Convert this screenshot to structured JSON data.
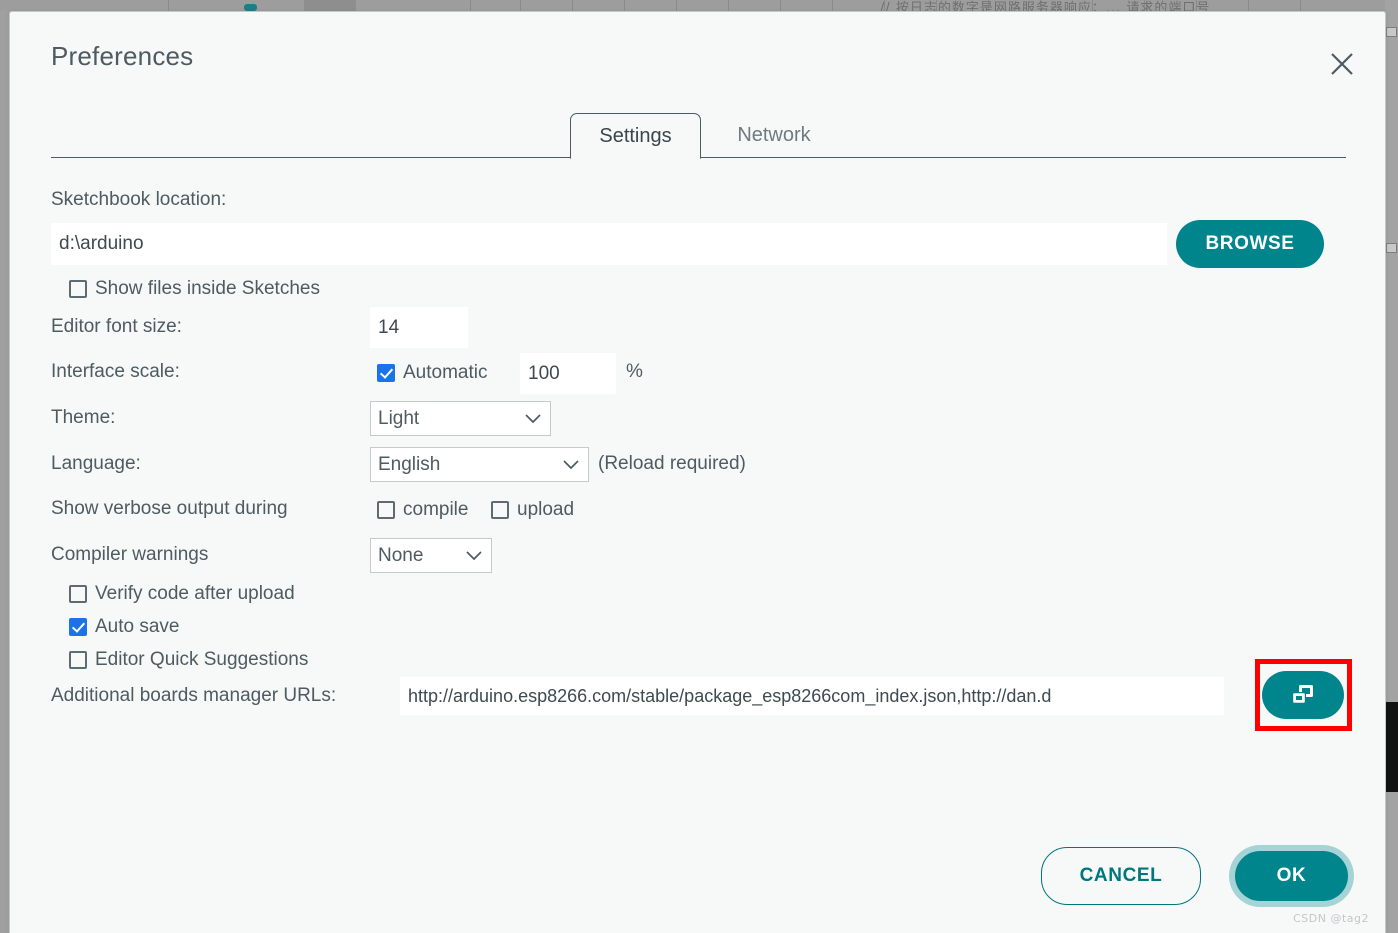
{
  "backdrop": {
    "code_text": "// 按日志的数字是网路服务器响应：... 请求的端口号"
  },
  "dialog": {
    "title": "Preferences",
    "close_icon": "close-icon",
    "tabs": [
      {
        "label": "Settings",
        "active": true
      },
      {
        "label": "Network",
        "active": false
      }
    ],
    "fields": {
      "sketchbook_label": "Sketchbook location:",
      "sketchbook_value": "d:\\arduino",
      "sketchbook_placeholder": "Sketchbook location",
      "browse_label": "BROWSE",
      "show_files_label": "Show files inside Sketches",
      "show_files_checked": false,
      "font_size_label": "Editor font size:",
      "font_size_value": "14",
      "interface_scale_label": "Interface scale:",
      "automatic_label": "Automatic",
      "automatic_checked": true,
      "scale_value": "100",
      "percent_symbol": "%",
      "theme_label": "Theme:",
      "theme_value": "Light",
      "language_label": "Language:",
      "language_value": "English",
      "reload_note": "(Reload required)",
      "verbose_label": "Show verbose output during",
      "verbose_compile_label": "compile",
      "verbose_compile_checked": false,
      "verbose_upload_label": "upload",
      "verbose_upload_checked": false,
      "compiler_warnings_label": "Compiler warnings",
      "compiler_warnings_value": "None",
      "verify_label": "Verify code after upload",
      "verify_checked": false,
      "autosave_label": "Auto save",
      "autosave_checked": true,
      "quick_suggestions_label": "Editor Quick Suggestions",
      "quick_suggestions_checked": false,
      "boards_urls_label": "Additional boards manager URLs:",
      "boards_urls_value": "http://arduino.esp8266.com/stable/package_esp8266com_index.json,http://dan.d",
      "boards_urls_button_icon": "open-windows-icon"
    },
    "footer": {
      "cancel_label": "CANCEL",
      "ok_label": "OK"
    }
  },
  "watermark": "CSDN @tag2",
  "colors": {
    "accent_teal": "#00858c",
    "accent_teal_dark": "#00777d",
    "checkbox_blue": "#1a73e8",
    "annotation_red": "#fe0000",
    "dialog_bg": "#f7f8f8",
    "text": "#4e5b61"
  }
}
